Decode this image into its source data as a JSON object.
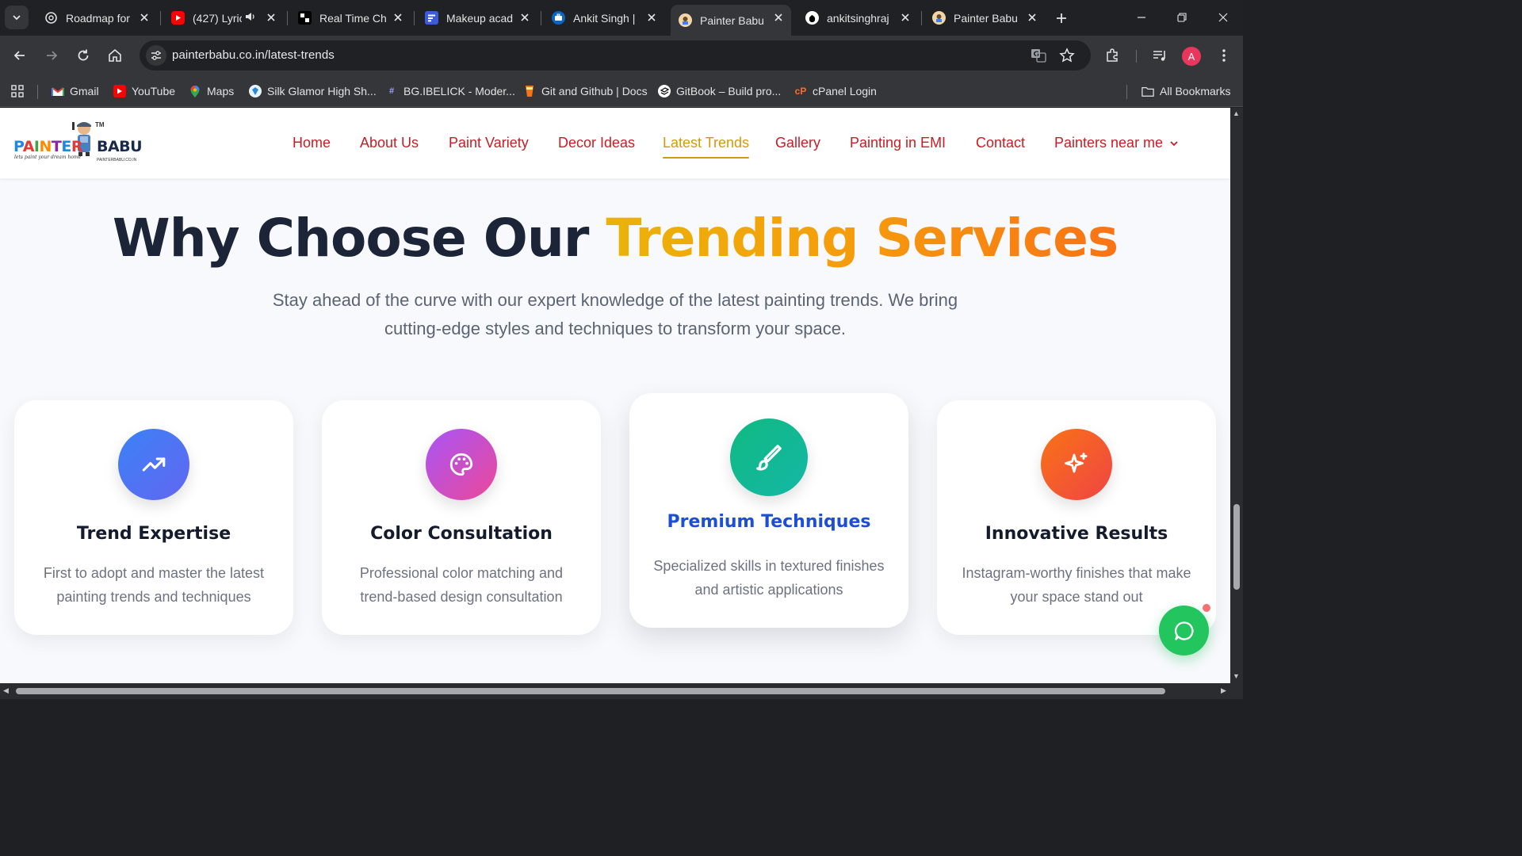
{
  "browser": {
    "tabs": [
      {
        "title": "Roadmap for",
        "icon": "openai-icon"
      },
      {
        "title": "(427) Lyric",
        "icon": "youtube-icon",
        "audio": true
      },
      {
        "title": "Real Time Ch",
        "icon": "app-icon"
      },
      {
        "title": "Makeup acad",
        "icon": "forms-icon"
      },
      {
        "title": "Ankit Singh |",
        "icon": "briefcase-icon"
      },
      {
        "title": "Painter Babu",
        "icon": "painterbabu-icon",
        "active": true
      },
      {
        "title": "ankitsinghraj",
        "icon": "github-icon"
      },
      {
        "title": "Painter Babu",
        "icon": "painterbabu-icon"
      }
    ],
    "url": "painterbabu.co.in/latest-trends",
    "profile_initial": "A",
    "bookmarks": [
      {
        "label": "Gmail",
        "icon": "gmail-icon"
      },
      {
        "label": "YouTube",
        "icon": "youtube-icon"
      },
      {
        "label": "Maps",
        "icon": "maps-icon"
      },
      {
        "label": "Silk Glamor High Sh...",
        "icon": "silk-icon"
      },
      {
        "label": "BG.IBELICK - Moder...",
        "icon": "hash-icon"
      },
      {
        "label": "Git and Github | Docs",
        "icon": "git-icon"
      },
      {
        "label": "GitBook – Build pro...",
        "icon": "gitbook-icon"
      },
      {
        "label": "cPanel Login",
        "icon": "cpanel-icon"
      }
    ],
    "all_bookmarks": "All Bookmarks"
  },
  "site": {
    "logo": {
      "left": "PAINTER",
      "right": "BABU",
      "tm": "TM",
      "tagline": "lets paint your dream home",
      "domain": "PAINTERBABU.CO.IN"
    },
    "nav": [
      "Home",
      "About Us",
      "Paint Variety",
      "Decor Ideas",
      "Latest Trends",
      "Gallery",
      "Painting in EMI",
      "Contact",
      "Painters near me"
    ],
    "active_nav": "Latest Trends",
    "hero": {
      "title_plain": "Why Choose Our ",
      "title_highlight": "Trending Services",
      "subtitle": "Stay ahead of the curve with our expert knowledge of the latest painting trends. We bring cutting-edge styles and techniques to transform your space."
    },
    "cards": [
      {
        "title": "Trend Expertise",
        "desc": "First to adopt and master the latest painting trends and techniques",
        "icon": "trending-up-icon",
        "color": "#3b82f6"
      },
      {
        "title": "Color Consultation",
        "desc": "Professional color matching and trend-based design consultation",
        "icon": "palette-icon",
        "color": "#c026d3"
      },
      {
        "title": "Premium Techniques",
        "desc": "Specialized skills in textured finishes and artistic applications",
        "icon": "paintbrush-icon",
        "color": "#10b981"
      },
      {
        "title": "Innovative Results",
        "desc": "Instagram-worthy finishes that make your space stand out",
        "icon": "sparkles-icon",
        "color": "#f97316"
      }
    ]
  }
}
